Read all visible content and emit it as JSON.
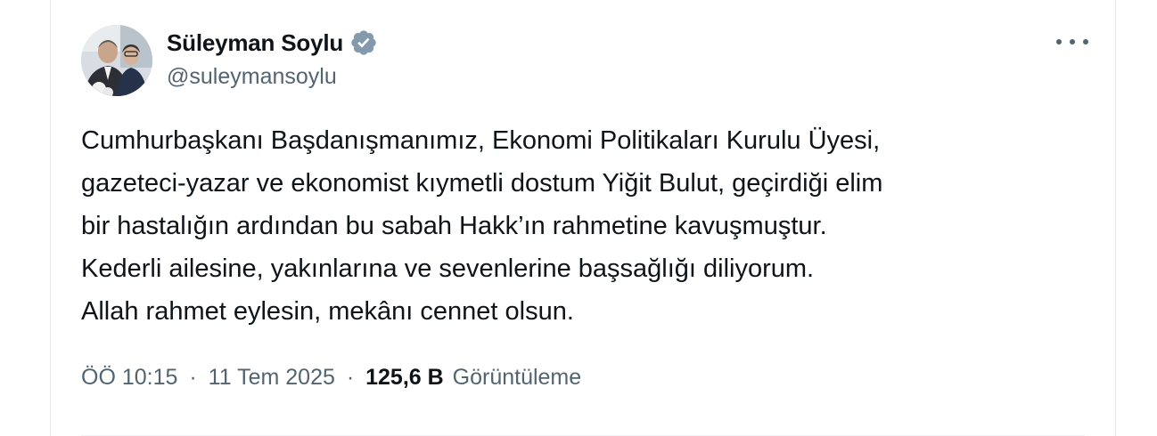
{
  "author": {
    "display_name": "Süleyman Soylu",
    "handle": "@suleymansoylu",
    "verified": true,
    "verified_color": "#829aab"
  },
  "tweet": {
    "lines": [
      "Cumhurbaşkanı Başdanışmanımız, Ekonomi Politikaları Kurulu Üyesi,",
      "gazeteci-yazar ve ekonomist kıymetli dostum Yiğit Bulut, geçirdiği elim",
      "bir hastalığın ardından bu sabah Hakk’ın rahmetine kavuşmuştur.",
      "Kederli ailesine, yakınlarına ve sevenlerine başsağlığı diliyorum.",
      "Allah rahmet eylesin, mekânı cennet olsun."
    ]
  },
  "meta": {
    "time": "ÖÖ 10:15",
    "separator": "·",
    "date": "11 Tem 2025",
    "views_count": "125,6 B",
    "views_label": "Görüntüleme"
  },
  "icons": {
    "more": "more-horizontal-icon",
    "verified": "verified-badge-icon"
  }
}
